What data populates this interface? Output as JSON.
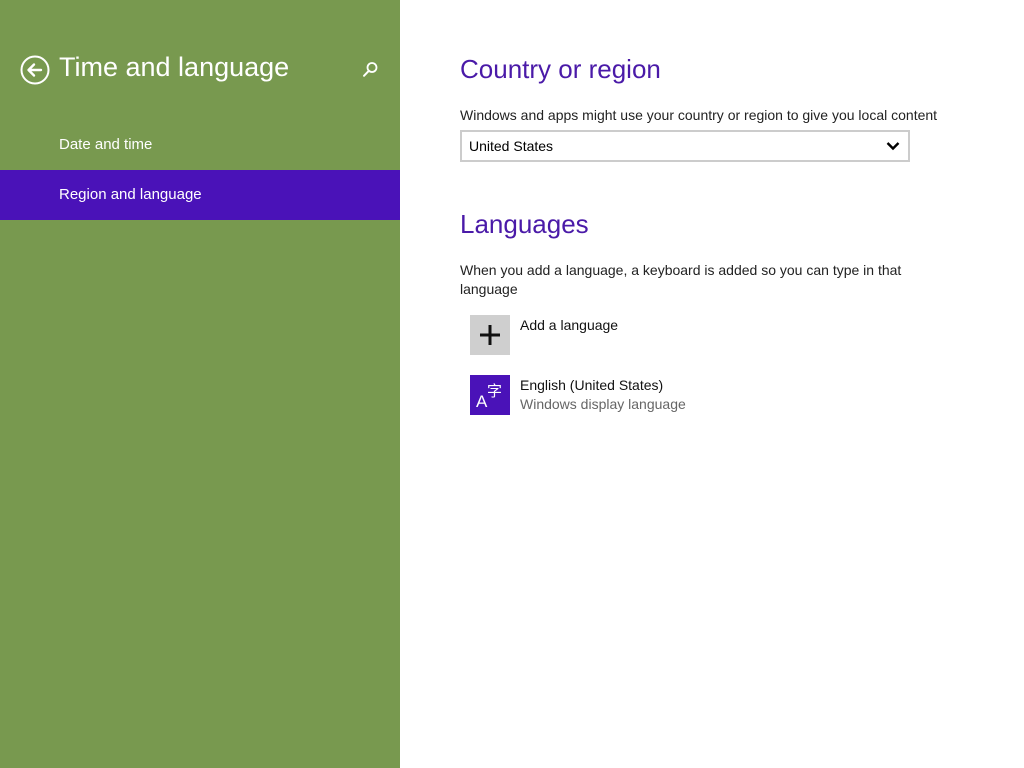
{
  "sidebar": {
    "title": "Time and language",
    "back_icon": "back-arrow-icon",
    "search_icon": "search-icon",
    "background_color": "#78994f",
    "selected_color": "#4a12b8",
    "items": [
      {
        "label": "Date and time",
        "selected": false
      },
      {
        "label": "Region and language",
        "selected": true
      }
    ]
  },
  "country": {
    "heading": "Country or region",
    "description": "Windows and apps might use your country or region to give you local content",
    "selected_value": "United States"
  },
  "languages": {
    "heading": "Languages",
    "description": "When you add a language, a keyboard is added so you can type in that language",
    "add_label": "Add a language",
    "add_icon": "plus-icon",
    "items": [
      {
        "name": "English (United States)",
        "detail": "Windows display language",
        "icon": "language-icon",
        "icon_latin": "A",
        "icon_cjk": "字"
      }
    ]
  },
  "accent_color": "#4a1aa8"
}
